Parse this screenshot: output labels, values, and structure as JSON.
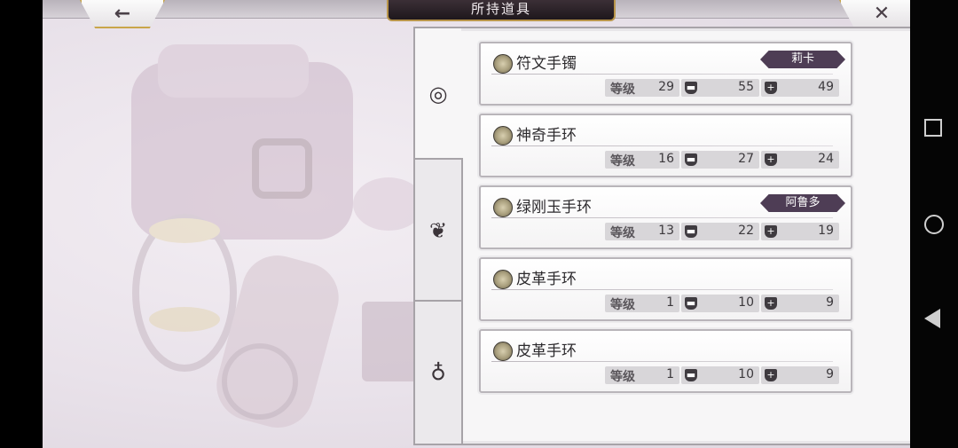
{
  "header": {
    "title": "所持道具",
    "back_icon": "←",
    "close_icon": "✕"
  },
  "tabs": [
    {
      "icon": "bracelet-icon",
      "glyph": "◎"
    },
    {
      "icon": "necklace-icon",
      "glyph": "❦"
    },
    {
      "icon": "ring-icon",
      "glyph": "♁"
    }
  ],
  "stat_labels": {
    "level": "等级"
  },
  "items": [
    {
      "name": "符文手镯",
      "owner": "莉卡",
      "level": "29",
      "defense": "55",
      "hp": "49"
    },
    {
      "name": "神奇手环",
      "owner": "",
      "level": "16",
      "defense": "27",
      "hp": "24"
    },
    {
      "name": "绿刚玉手环",
      "owner": "阿鲁多",
      "level": "13",
      "defense": "22",
      "hp": "19"
    },
    {
      "name": "皮革手环",
      "owner": "",
      "level": "1",
      "defense": "10",
      "hp": "9"
    },
    {
      "name": "皮革手环",
      "owner": "",
      "level": "1",
      "defense": "10",
      "hp": "9"
    }
  ],
  "colors": {
    "owner_badge": "#4e3d55",
    "frame_gold": "#c9a64a",
    "panel_border": "#a7a3a8"
  }
}
